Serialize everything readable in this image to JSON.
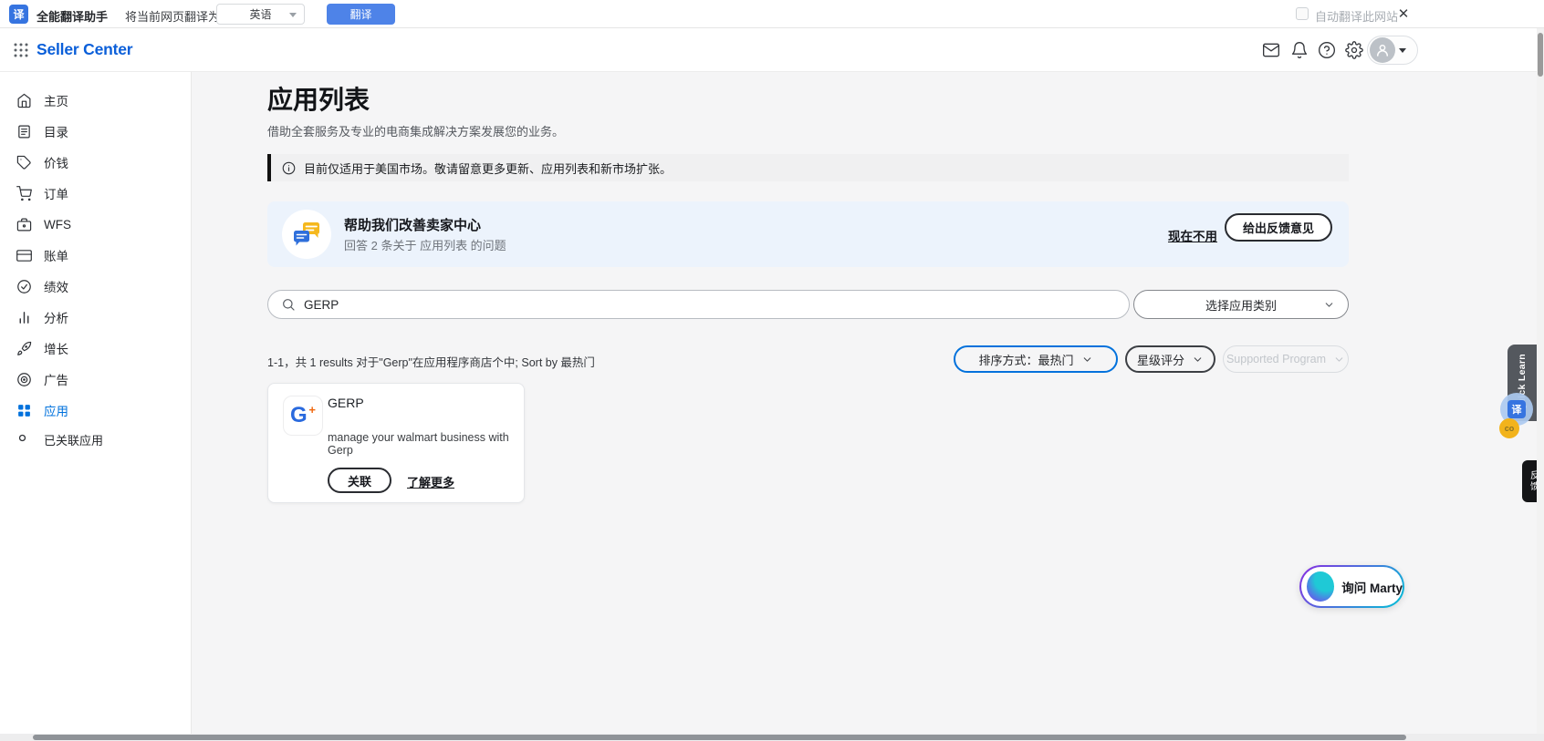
{
  "colors": {
    "accent_blue": "#0071dc",
    "brand_blue": "#0b5fd9",
    "translate_button_bg": "#4e83e8",
    "feedback_card_bg": "#ecf3fc",
    "banner_bg": "#f0f0f1",
    "coin_yellow": "#f2b31c",
    "marty_gradient": [
      "#8a2be2",
      "#00c2d6"
    ]
  },
  "translate_bar": {
    "logo_glyph": "译",
    "title": "全能翻译助手",
    "target_label": "将当前网页翻译为:",
    "language_value": "英语",
    "translate_button": "翻译",
    "auto_translate_label": "自动翻译此网站",
    "close_glyph": "✕"
  },
  "header": {
    "brand": "Seller Center",
    "icons": [
      "apps-grid-icon",
      "mail-icon",
      "bell-icon",
      "help-icon",
      "gear-icon",
      "avatar"
    ]
  },
  "sidebar": {
    "items": [
      {
        "label": "主页",
        "icon": "home"
      },
      {
        "label": "目录",
        "icon": "catalog"
      },
      {
        "label": "价钱",
        "icon": "price-tag"
      },
      {
        "label": "订单",
        "icon": "cart"
      },
      {
        "label": "WFS",
        "icon": "box"
      },
      {
        "label": "账单",
        "icon": "billing-card"
      },
      {
        "label": "绩效",
        "icon": "gauge"
      },
      {
        "label": "分析",
        "icon": "bar-chart"
      },
      {
        "label": "增长",
        "icon": "rocket"
      },
      {
        "label": "广告",
        "icon": "target"
      },
      {
        "label": "应用",
        "icon": "apps",
        "active": true
      },
      {
        "label": "已关联应用",
        "icon": "circle",
        "sub": true
      }
    ]
  },
  "main": {
    "title": "应用列表",
    "subtitle": "借助全套服务及专业的电商集成解决方案发展您的业务。",
    "notice": "目前仅适用于美国市场。敬请留意更多更新、应用列表和新市场扩张。",
    "feedback": {
      "title": "帮助我们改善卖家中心",
      "subtitle": "回答 2 条关于 应用列表 的问题",
      "dismiss_label": "现在不用",
      "cta_label": "给出反馈意见"
    },
    "search": {
      "value": "GERP"
    },
    "category_dropdown_label": "选择应用类别",
    "results_summary": "1-1，共 1 results 对于\"Gerp\"在应用程序商店个中; Sort by 最热门",
    "filters": {
      "sort_label": "排序方式：最热门",
      "rating_label": "星级评分",
      "supported_label": "Supported Program"
    },
    "app_card": {
      "name": "GERP",
      "logo_glyph": "G",
      "logo_plus_glyph": "+",
      "description": "manage your walmart business with Gerp",
      "connect_label": "关联",
      "learn_more_label": "了解更多"
    }
  },
  "floats": {
    "marty_label": "询问 Marty",
    "quick_learn_label": "Quick Learn",
    "translate_float_glyph": "译",
    "coin_label": "co",
    "feedback_tab_label": "反馈"
  }
}
